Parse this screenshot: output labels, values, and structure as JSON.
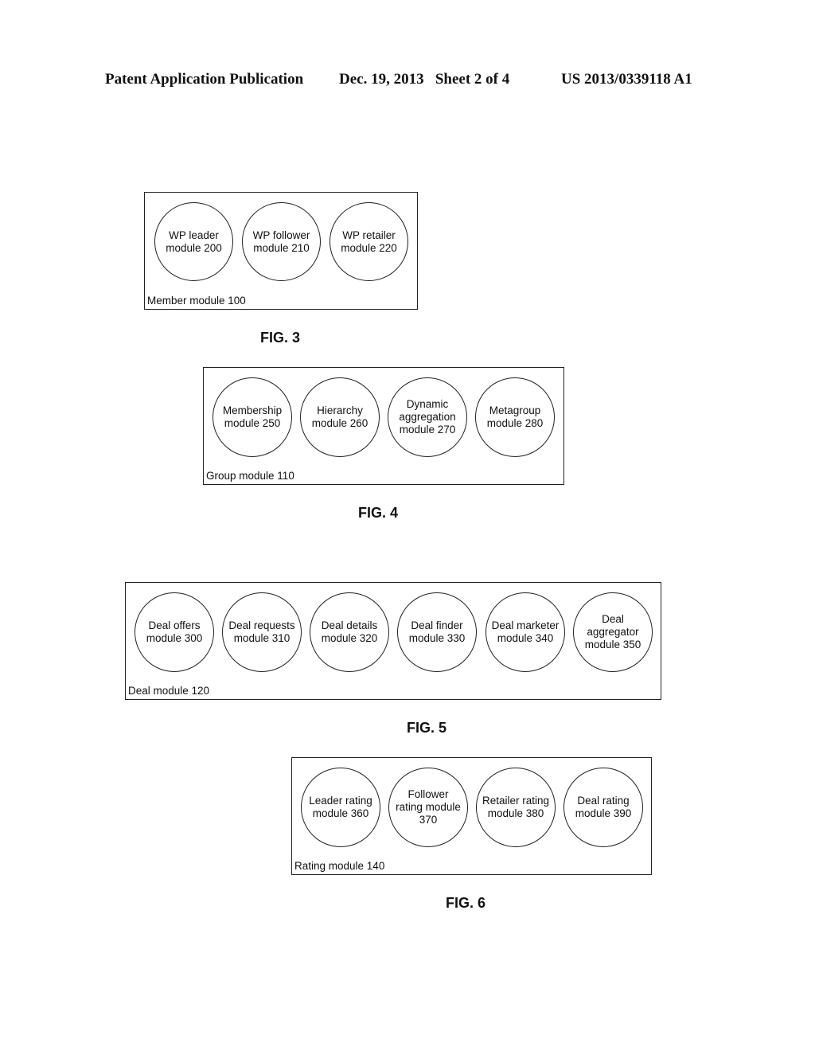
{
  "header": {
    "publication": "Patent Application Publication",
    "date_sheet": "Dec. 19, 2013   Sheet 2 of 4",
    "number": "US 2013/0339118 A1"
  },
  "figures": [
    {
      "caption": "FIG. 3",
      "container_label": "Member module 100",
      "modules": [
        {
          "line1": "WP leader",
          "line2": "module 200",
          "line3": ""
        },
        {
          "line1": "WP follower",
          "line2": "module 210",
          "line3": ""
        },
        {
          "line1": "WP retailer",
          "line2": "module 220",
          "line3": ""
        }
      ]
    },
    {
      "caption": "FIG. 4",
      "container_label": "Group module 110",
      "modules": [
        {
          "line1": "Membership",
          "line2": "module 250",
          "line3": ""
        },
        {
          "line1": "Hierarchy",
          "line2": "module 260",
          "line3": ""
        },
        {
          "line1": "Dynamic",
          "line2": "aggregation",
          "line3": "module 270"
        },
        {
          "line1": "Metagroup",
          "line2": "module 280",
          "line3": ""
        }
      ]
    },
    {
      "caption": "FIG. 5",
      "container_label": "Deal module 120",
      "modules": [
        {
          "line1": "Deal offers",
          "line2": "module 300",
          "line3": ""
        },
        {
          "line1": "Deal requests",
          "line2": "module 310",
          "line3": ""
        },
        {
          "line1": "Deal details",
          "line2": "module 320",
          "line3": ""
        },
        {
          "line1": "Deal finder",
          "line2": "module 330",
          "line3": ""
        },
        {
          "line1": "Deal marketer",
          "line2": "module 340",
          "line3": ""
        },
        {
          "line1": "Deal",
          "line2": "aggregator",
          "line3": "module 350"
        }
      ]
    },
    {
      "caption": "FIG. 6",
      "container_label": "Rating module 140",
      "modules": [
        {
          "line1": "Leader rating",
          "line2": "module 360",
          "line3": ""
        },
        {
          "line1": "Follower",
          "line2": "rating module",
          "line3": "370"
        },
        {
          "line1": "Retailer rating",
          "line2": "module 380",
          "line3": ""
        },
        {
          "line1": "Deal rating",
          "line2": "module 390",
          "line3": ""
        }
      ]
    }
  ]
}
